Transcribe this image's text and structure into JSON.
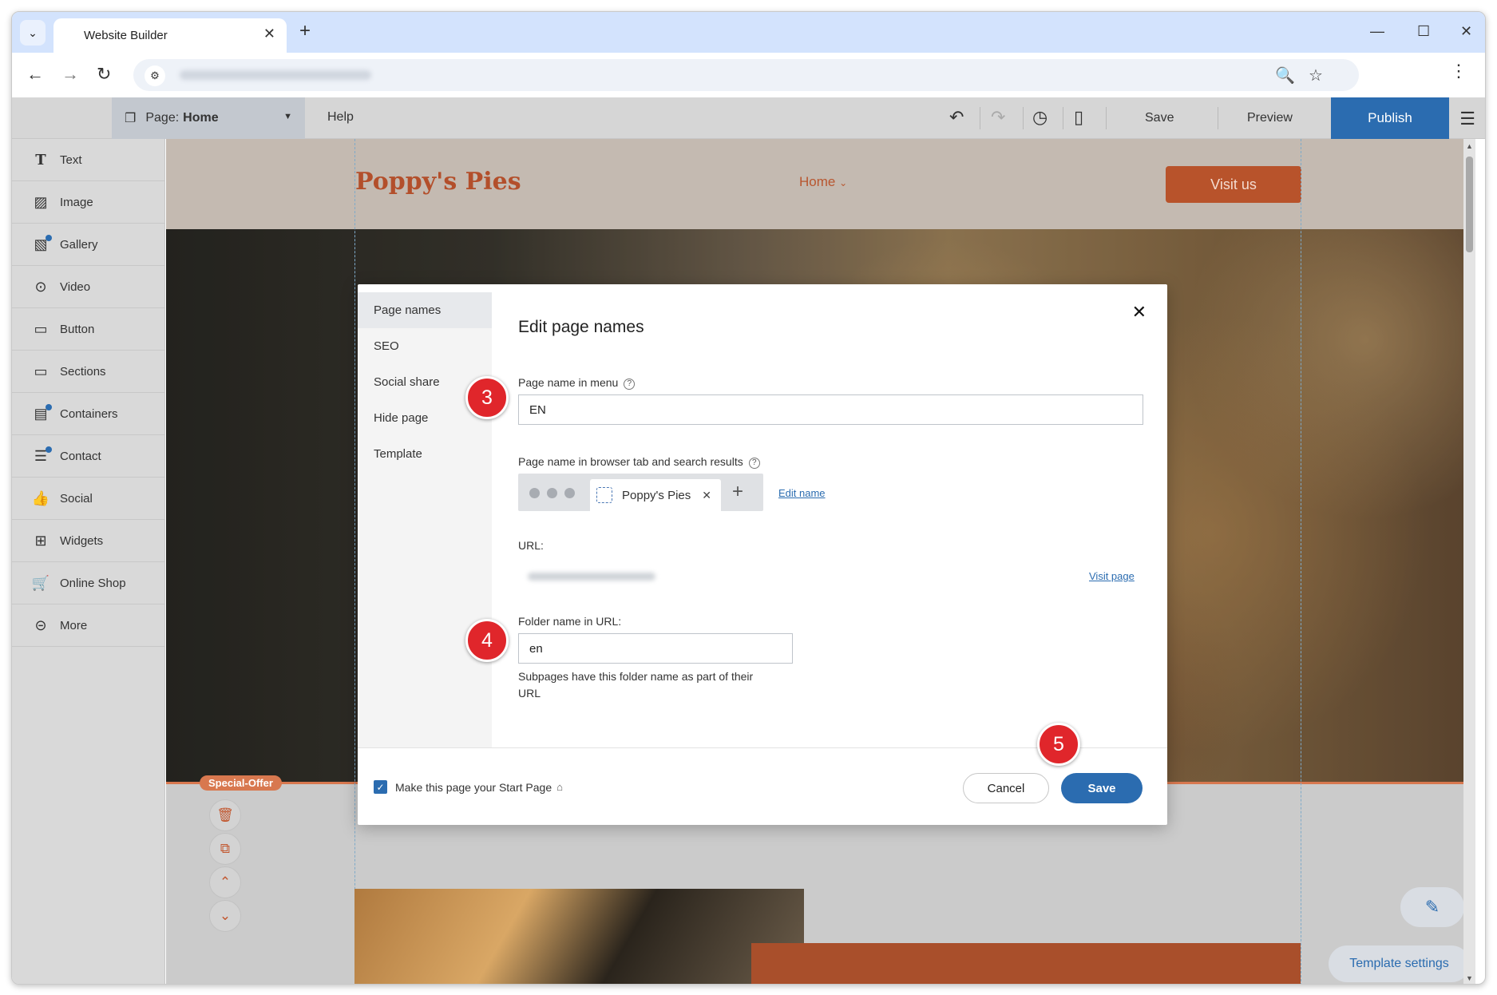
{
  "browser": {
    "tab_title": "Website Builder",
    "tab_close": "✕",
    "new_tab": "+",
    "menu_caret": "⌄",
    "win_min": "—",
    "win_max": "☐",
    "win_close": "✕"
  },
  "builder": {
    "page_label": "Page:",
    "page_value": "Home",
    "help": "Help",
    "save": "Save",
    "preview": "Preview",
    "publish": "Publish"
  },
  "sidebar": {
    "items": [
      {
        "label": "Text",
        "icon": "text-icon"
      },
      {
        "label": "Image",
        "icon": "image-icon"
      },
      {
        "label": "Gallery",
        "icon": "gallery-icon"
      },
      {
        "label": "Video",
        "icon": "video-icon"
      },
      {
        "label": "Button",
        "icon": "button-icon"
      },
      {
        "label": "Sections",
        "icon": "sections-icon"
      },
      {
        "label": "Containers",
        "icon": "containers-icon"
      },
      {
        "label": "Contact",
        "icon": "contact-icon"
      },
      {
        "label": "Social",
        "icon": "social-icon"
      },
      {
        "label": "Widgets",
        "icon": "widgets-icon"
      },
      {
        "label": "Online Shop",
        "icon": "cart-icon"
      },
      {
        "label": "More",
        "icon": "more-icon"
      }
    ]
  },
  "site": {
    "logo": "Poppy's Pies",
    "nav_home": "Home",
    "visit_btn": "Visit us",
    "special_badge": "Special-Offer",
    "template_settings": "Template settings"
  },
  "modal": {
    "nav": [
      "Page names",
      "SEO",
      "Social share",
      "Hide page",
      "Template"
    ],
    "title": "Edit page names",
    "menu_name_label": "Page name in menu",
    "menu_name_value": "EN",
    "browser_tab_label": "Page name in browser tab and search results",
    "tab_preview_title": "Poppy's Pies",
    "edit_name_link": "Edit name",
    "url_label": "URL:",
    "visit_page_link": "Visit page",
    "folder_label": "Folder name in URL:",
    "folder_value": "en",
    "folder_hint": "Subpages have this folder name as part of their URL",
    "start_page_label": "Make this page your Start Page",
    "cancel": "Cancel",
    "save": "Save"
  },
  "steps": [
    "3",
    "4",
    "5"
  ],
  "colors": {
    "accent_blue": "#2b6cb0",
    "brand_orange": "#b8532b",
    "step_red": "#e0262b"
  }
}
